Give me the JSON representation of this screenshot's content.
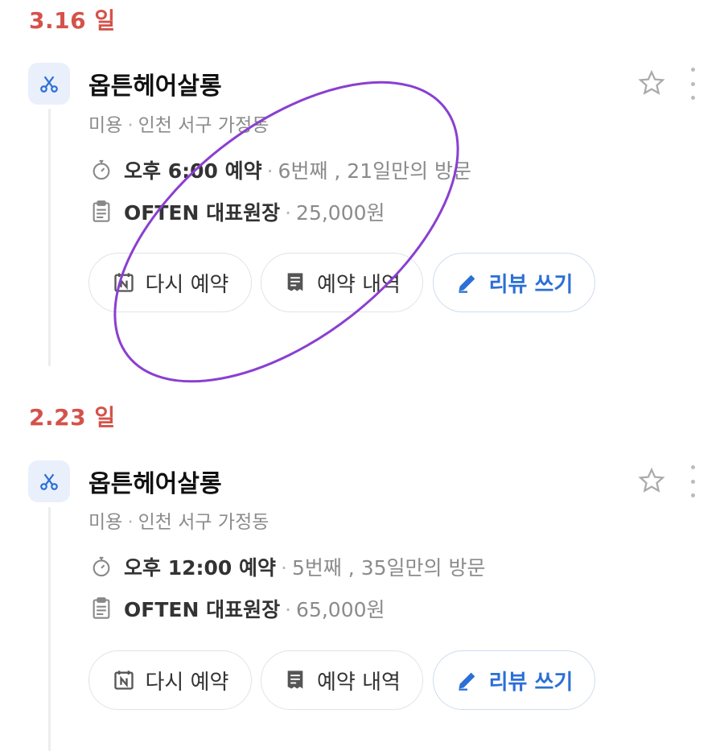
{
  "entries": [
    {
      "date": "3.16 일",
      "shop_name": "옵튼헤어살롱",
      "category": "미용",
      "location": "인천 서구 가정동",
      "time": "오후 6:00 예약",
      "visit_info": "6번째 , 21일만의 방문",
      "menu": "OFTEN 대표원장",
      "price": "25,000원",
      "buttons": {
        "rebook": "다시 예약",
        "history": "예약 내역",
        "review": "리뷰 쓰기"
      }
    },
    {
      "date": "2.23 일",
      "shop_name": "옵튼헤어살롱",
      "category": "미용",
      "location": "인천 서구 가정동",
      "time": "오후 12:00 예약",
      "visit_info": "5번째 , 35일만의 방문",
      "menu": "OFTEN 대표원장",
      "price": "65,000원",
      "buttons": {
        "rebook": "다시 예약",
        "history": "예약 내역",
        "review": "리뷰 쓰기"
      }
    }
  ],
  "separator_dot": "·",
  "colors": {
    "date": "#d4524a",
    "accent": "#2c6fd6",
    "annotation": "#8a3fd1"
  },
  "icons": [
    "scissors-icon",
    "stopwatch-icon",
    "clipboard-icon",
    "naver-calendar-icon",
    "receipt-icon",
    "pencil-icon",
    "star-icon",
    "more-icon"
  ]
}
